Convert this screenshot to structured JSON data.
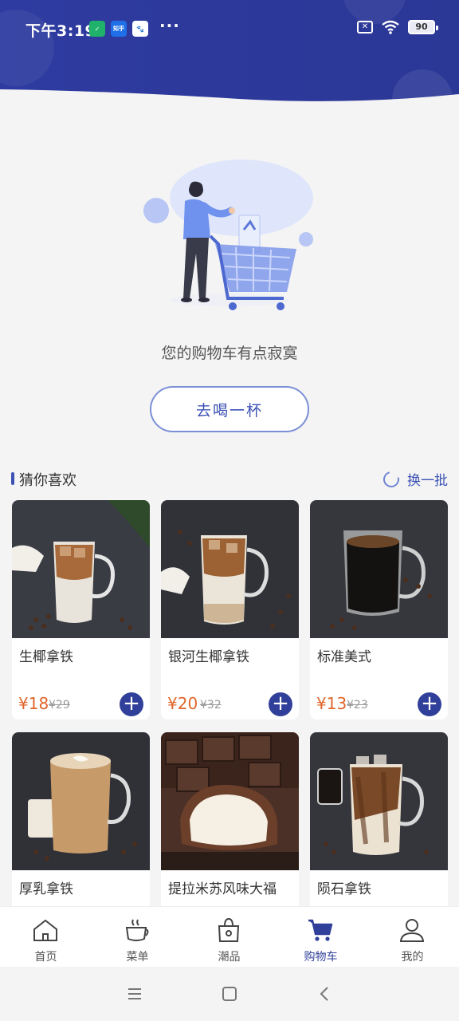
{
  "status_bar": {
    "time": "下午3:19",
    "more": "···",
    "battery": "90",
    "app_icons": [
      "shield-app-icon",
      "zhihu-app-icon",
      "baidu-app-icon"
    ],
    "zhihu_text": "知乎"
  },
  "cart": {
    "empty_message": "您的购物车有点寂寞",
    "cta_label": "去喝一杯"
  },
  "recommend": {
    "title": "猜你喜欢",
    "refresh_label": "换一批",
    "products": [
      {
        "name": "生椰拿铁",
        "price": "¥18",
        "original_price": "¥29"
      },
      {
        "name": "银河生椰拿铁",
        "price": "¥20",
        "original_price": "¥32"
      },
      {
        "name": "标准美式",
        "price": "¥13",
        "original_price": "¥23"
      },
      {
        "name": "厚乳拿铁"
      },
      {
        "name": "提拉米苏风味大福"
      },
      {
        "name": "陨石拿铁"
      }
    ]
  },
  "tab_bar": {
    "items": [
      {
        "label": "首页",
        "icon": "home-icon"
      },
      {
        "label": "菜单",
        "icon": "coffee-cup-icon"
      },
      {
        "label": "潮品",
        "icon": "shopping-bag-icon"
      },
      {
        "label": "购物车",
        "icon": "cart-icon",
        "active": true
      },
      {
        "label": "我的",
        "icon": "user-icon"
      }
    ]
  },
  "colors": {
    "brand": "#30409a",
    "header": "#2f3a9e",
    "price": "#e0652a",
    "background": "#f4f4f4"
  }
}
